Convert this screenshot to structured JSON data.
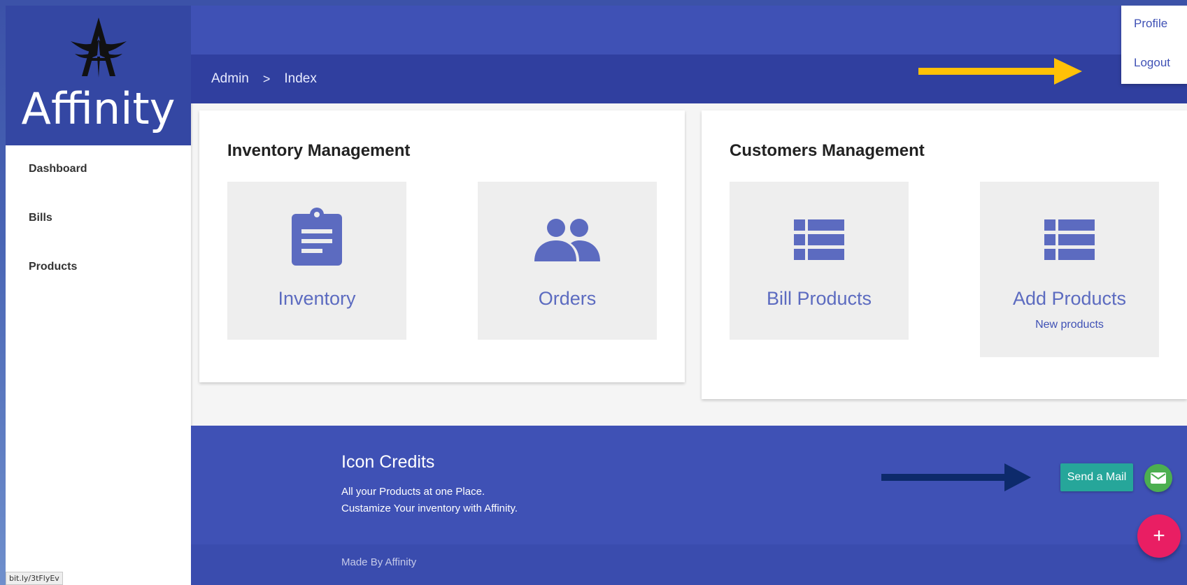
{
  "brand": {
    "name": "Affinity",
    "logo_icon": "winged-a-logo"
  },
  "sidebar": {
    "items": [
      {
        "label": "Dashboard"
      },
      {
        "label": "Bills"
      },
      {
        "label": "Products"
      }
    ]
  },
  "status_bar": {
    "url": "bit.ly/3tFlyEv"
  },
  "breadcrumb": {
    "parent": "Admin",
    "separator": ">",
    "current": "Index"
  },
  "user_menu": {
    "items": [
      {
        "label": "Profile"
      },
      {
        "label": "Logout"
      }
    ]
  },
  "cards": [
    {
      "title": "Inventory Management",
      "tiles": [
        {
          "label": "Inventory",
          "icon": "clipboard-icon",
          "sub": ""
        },
        {
          "label": "Orders",
          "icon": "people-icon",
          "sub": ""
        }
      ]
    },
    {
      "title": "Customers Management",
      "tiles": [
        {
          "label": "Bill Products",
          "icon": "list-icon",
          "sub": ""
        },
        {
          "label": "Add Products",
          "icon": "list-icon",
          "sub": "New products"
        }
      ]
    }
  ],
  "footer": {
    "title": "Icon Credits",
    "lines": [
      "All your Products at one Place.",
      "Custamize Your inventory with Affinity."
    ],
    "made_by": "Made By Affinity",
    "send_mail": "Send a Mail",
    "fab_symbol": "+"
  },
  "colors": {
    "primary": "#3f51b5",
    "primary_dark": "#303f9f",
    "tile_icon": "#5c6bc0",
    "annotation_arrow_1": "#ffc107",
    "annotation_arrow_2": "#0d2a6b",
    "send_mail": "#26a69a",
    "fab": "#e91e63"
  }
}
